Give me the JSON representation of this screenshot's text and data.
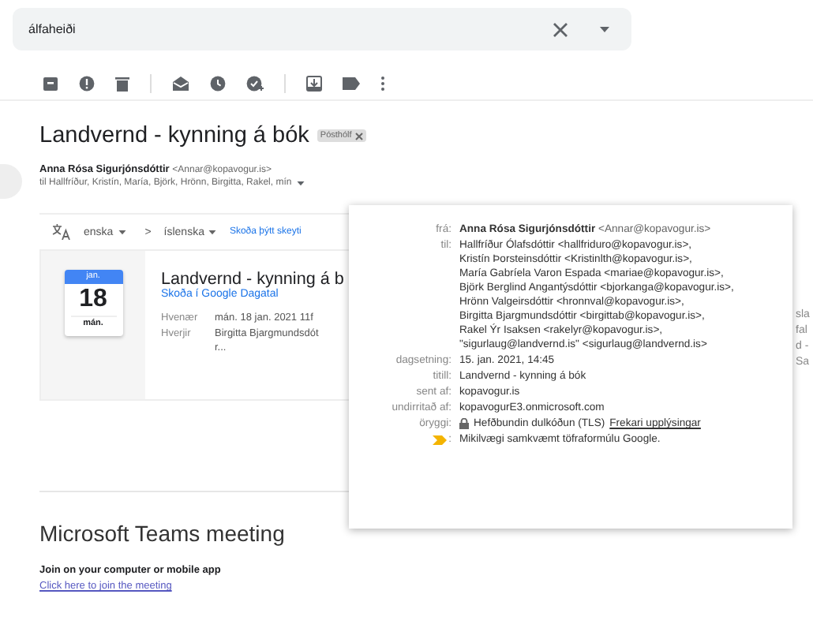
{
  "search": {
    "value": "álfaheiði"
  },
  "message": {
    "subject": "Landvernd - kynning á bók",
    "label": {
      "text": "Pósthólf"
    },
    "sender_name": "Anna Rósa Sigurjónsdóttir",
    "sender_email": "<Annar@kopavogur.is>",
    "to_line": "til Hallfríður, Kristín, María, Björk, Hrönn, Birgitta, Rakel, mín"
  },
  "translate": {
    "from": "enska",
    "arrow": ">",
    "to": "íslenska",
    "link": "Skoða þýtt skeyti"
  },
  "invite": {
    "month": "jan.",
    "day": "18",
    "weekday": "mán.",
    "title": "Landvernd - kynning á b",
    "calendar_link": "Skoða í Google Dagatal",
    "fields": [
      {
        "label": "Hvenær",
        "value": "mán. 18 jan. 2021 11f"
      },
      {
        "label": "Hverjir",
        "value": "Birgitta Bjargmundsdót",
        "more": "r..."
      }
    ]
  },
  "details_popup": {
    "rows": [
      {
        "kind": "sender",
        "label": "frá:",
        "name": "Anna Rósa Sigurjónsdóttir",
        "value": "<Annar@kopavogur.is>"
      },
      {
        "kind": "list",
        "label": "til:",
        "lines": [
          "Hallfríður Ólafsdóttir <hallfriduro@kopavogur.is>,",
          "Kristín Þorsteinsdóttir <Kristinlth@kopavogur.is>,",
          "María Gabríela Varon Espada <mariae@kopavogur.is>,",
          "Björk Berglind Angantýsdóttir <bjorkanga@kopavogur.is>,",
          "Hrönn Valgeirsdóttir <hronnval@kopavogur.is>,",
          "Birgitta Bjargmundsdóttir <birgittab@kopavogur.is>,",
          "Rakel Ýr Isaksen <rakelyr@kopavogur.is>,",
          "\"sigurlaug@landvernd.is\" <sigurlaug@landvernd.is>"
        ]
      },
      {
        "kind": "text",
        "label": "dagsetning:",
        "value": "15. jan. 2021, 14:45"
      },
      {
        "kind": "text",
        "label": "titill:",
        "value": "Landvernd - kynning á bók"
      },
      {
        "kind": "text",
        "label": "sent af:",
        "value": "kopavogur.is"
      },
      {
        "kind": "text",
        "label": "undirritað af:",
        "value": "kopavogurE3.onmicrosoft.com"
      },
      {
        "kind": "security",
        "label": "öryggi:",
        "value": "Hefðbundin dulkóðun (TLS)",
        "link": "Frekari upplýsingar"
      },
      {
        "kind": "importance",
        "label": ":",
        "value": "Mikilvægi samkvæmt töfraformúlu Google."
      }
    ]
  },
  "edge_fragments": [
    "sla",
    "fal",
    "d -",
    "Sa"
  ],
  "teams": {
    "title": "Microsoft Teams meeting",
    "subtitle": "Join on your computer or mobile app",
    "link": "Click here to join the meeting"
  }
}
